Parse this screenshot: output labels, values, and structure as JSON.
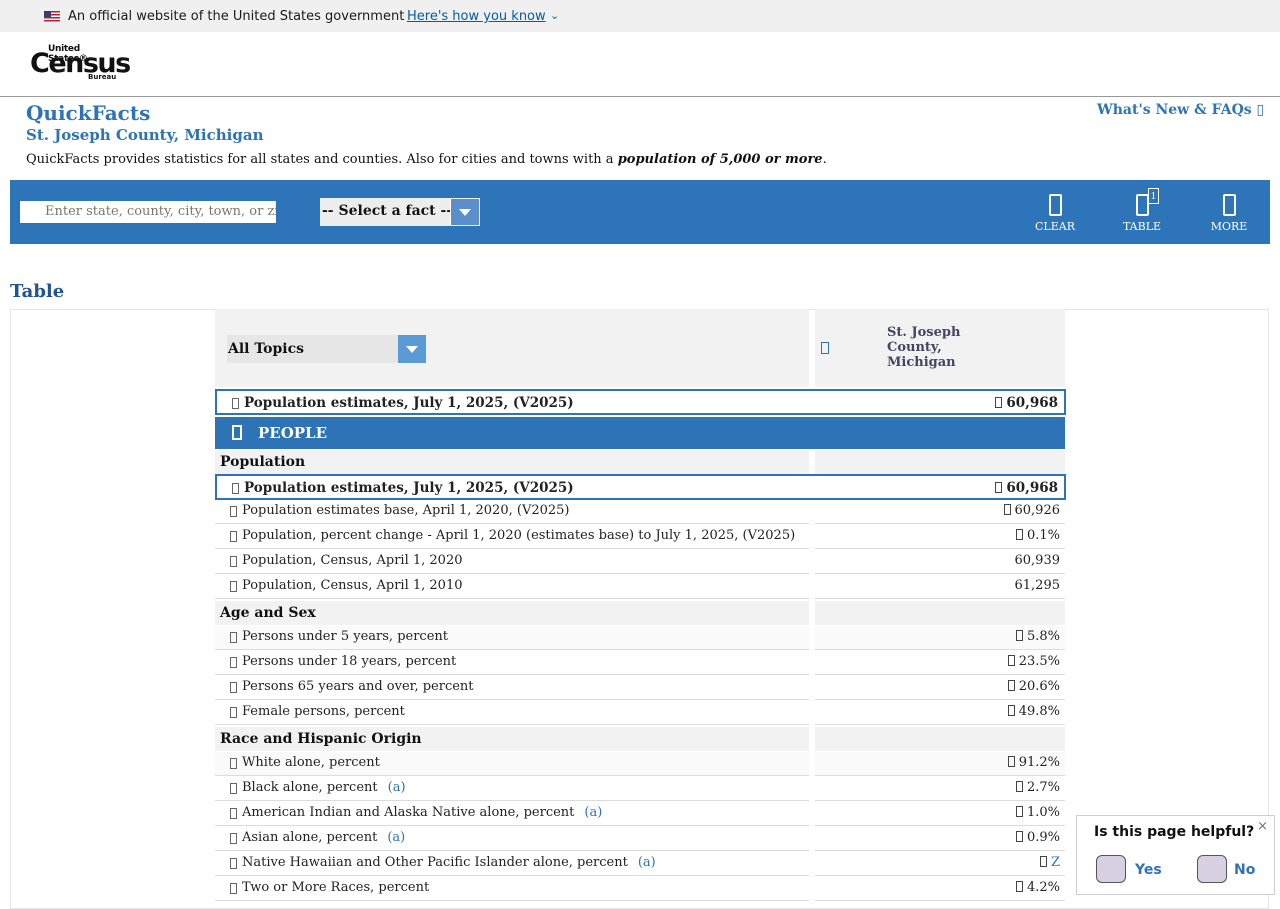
{
  "gov_banner": {
    "text": "An official website of the United States government",
    "link": "Here's how you know",
    "chevron": "⌄"
  },
  "logo": {
    "top": "United States®",
    "main": "Census",
    "bottom": "Bureau"
  },
  "header": {
    "title": "QuickFacts",
    "subtitle": "St. Joseph County, Michigan",
    "description_prefix": "QuickFacts provides statistics for all states and counties. Also for cities and towns with a ",
    "description_emphasis": "population of 5,000 or more",
    "description_suffix": ".",
    "whats_new": "What's New & FAQs ▯"
  },
  "toolbar": {
    "search_placeholder": "Enter state, county, city, town, or zip code",
    "fact_select": "-- Select a fact --",
    "clear_label": "CLEAR",
    "table_label": "TABLE",
    "table_badge": "1",
    "more_label": "MORE"
  },
  "section_heading": "Table",
  "table": {
    "topic_select": "All Topics",
    "column_header": "St. Joseph County, Michigan",
    "top_row": {
      "label": "Population estimates, July 1, 2025, (V2025)",
      "value": "60,968"
    },
    "people_label": "PEOPLE",
    "groups": {
      "population": "Population",
      "age_sex": "Age and Sex",
      "race": "Race and Hispanic Origin"
    },
    "rows": [
      {
        "label": "Population estimates, July 1, 2025, (V2025)",
        "value": "60,968"
      },
      {
        "label": "Population estimates base, April 1, 2020, (V2025)",
        "value": "60,926"
      },
      {
        "label": "Population, percent change - April 1, 2020 (estimates base) to July 1, 2025, (V2025)",
        "value": "0.1%"
      },
      {
        "label": "Population, Census, April 1, 2020",
        "value": "60,939"
      },
      {
        "label": "Population, Census, April 1, 2010",
        "value": "61,295"
      },
      {
        "label": "Persons under 5 years, percent",
        "value": "5.8%"
      },
      {
        "label": "Persons under 18 years, percent",
        "value": "23.5%"
      },
      {
        "label": "Persons 65 years and over, percent",
        "value": "20.6%"
      },
      {
        "label": "Female persons, percent",
        "value": "49.8%"
      },
      {
        "label": "White alone, percent",
        "value": "91.2%"
      },
      {
        "label": "Black alone, percent",
        "note": "(a)",
        "value": "2.7%"
      },
      {
        "label": "American Indian and Alaska Native alone, percent",
        "note": "(a)",
        "value": "1.0%"
      },
      {
        "label": "Asian alone, percent",
        "note": "(a)",
        "value": "0.9%"
      },
      {
        "label": "Native Hawaiian and Other Pacific Islander alone, percent",
        "note": "(a)",
        "value": "Z"
      },
      {
        "label": "Two or More Races, percent",
        "value": "4.2%"
      }
    ]
  },
  "feedback": {
    "question": "Is this page helpful?",
    "yes": "Yes",
    "no": "No",
    "close": "×"
  },
  "colors": {
    "brand_blue": "#2e74b8",
    "link_blue": "#2d73b5"
  }
}
